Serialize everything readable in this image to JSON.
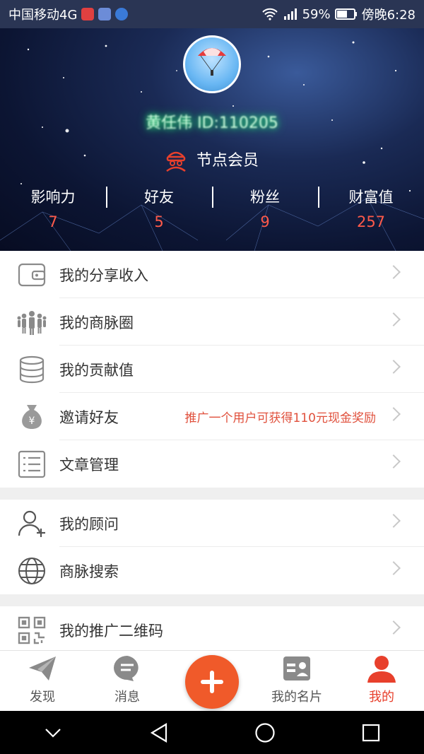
{
  "status_bar": {
    "carrier": "中国移动4G",
    "battery": "59%",
    "time": "傍晚6:28"
  },
  "profile": {
    "username": "黄任伟 ID:110205",
    "member_level": "节点会员",
    "stats": [
      {
        "label": "影响力",
        "value": "7"
      },
      {
        "label": "好友",
        "value": "5"
      },
      {
        "label": "粉丝",
        "value": "9"
      },
      {
        "label": "财富值",
        "value": "257"
      }
    ]
  },
  "menu": {
    "group1": [
      {
        "label": "我的分享收入",
        "icon": "wallet-icon"
      },
      {
        "label": "我的商脉圈",
        "icon": "people-icon"
      },
      {
        "label": "我的贡献值",
        "icon": "database-icon"
      },
      {
        "label": "邀请好友",
        "icon": "money-bag-icon",
        "promo": "推广一个用户可获得110元现金奖励"
      },
      {
        "label": "文章管理",
        "icon": "list-icon"
      }
    ],
    "group2": [
      {
        "label": "我的顾问",
        "icon": "add-user-icon"
      },
      {
        "label": "商脉搜索",
        "icon": "globe-icon"
      }
    ],
    "group3": [
      {
        "label": "我的推广二维码",
        "icon": "qr-code-icon"
      }
    ]
  },
  "tabbar": {
    "discover": "发现",
    "messages": "消息",
    "card": "我的名片",
    "me": "我的"
  },
  "colors": {
    "accent": "#e8402c",
    "plus_button": "#f05a2a",
    "stat_value": "#ff5a4a",
    "promo": "#e0503c"
  }
}
